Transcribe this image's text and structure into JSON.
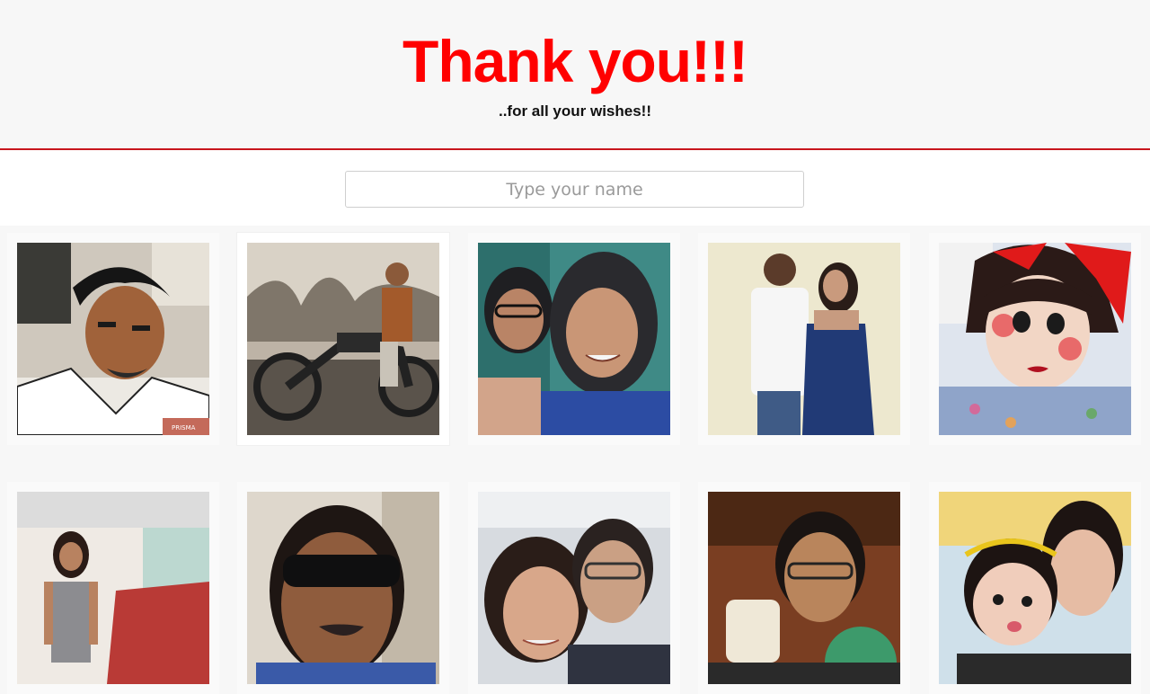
{
  "header": {
    "title": "Thank you!!!",
    "subtitle": "..for all your wishes!!",
    "title_color": "#ff0000",
    "rule_color": "#c8161d"
  },
  "search": {
    "placeholder": "Type your name",
    "value": ""
  },
  "gallery": {
    "photos": [
      {
        "subject": "man-selfie-prisma-filter",
        "badge": "PRISMA"
      },
      {
        "subject": "man-on-motorcycle"
      },
      {
        "subject": "two-women-selfie"
      },
      {
        "subject": "couple-standing"
      },
      {
        "subject": "girl-with-red-bow-filter"
      },
      {
        "subject": "woman-at-wedding-hall"
      },
      {
        "subject": "man-with-sunglasses"
      },
      {
        "subject": "couple-selfie-in-car"
      },
      {
        "subject": "man-with-glasses"
      },
      {
        "subject": "woman-and-child"
      }
    ]
  }
}
